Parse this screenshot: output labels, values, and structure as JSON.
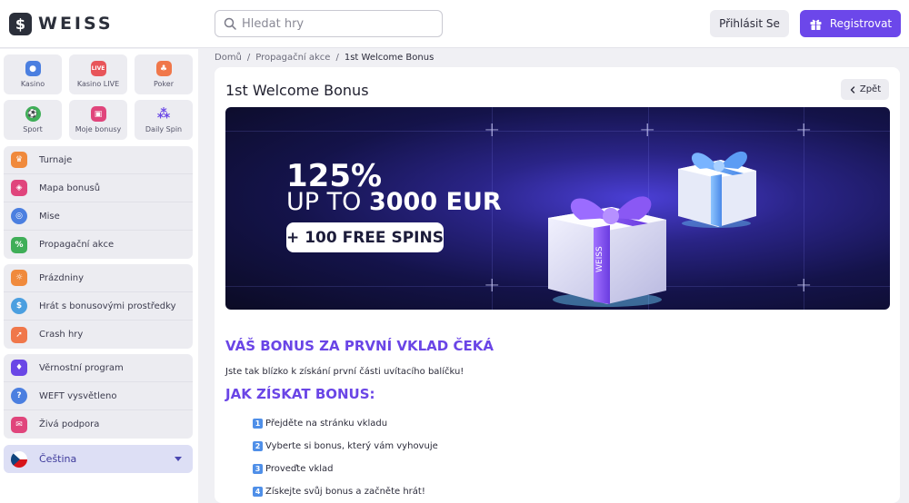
{
  "header": {
    "logo_text": "WEISS",
    "logo_mark": "$",
    "search_placeholder": "Hledat hry",
    "login_label": "Přihlásit Se",
    "register_label": "Registrovat"
  },
  "sidebar": {
    "tiles": [
      {
        "label": "Kasino",
        "icon": "casino-icon",
        "color": "#4b7fe0"
      },
      {
        "label": "Kasino LIVE",
        "icon": "live-casino-icon",
        "color": "#e8555a"
      },
      {
        "label": "Poker",
        "icon": "poker-icon",
        "color": "#f0774a"
      },
      {
        "label": "Sport",
        "icon": "sport-icon",
        "color": "#3fae58"
      },
      {
        "label": "Moje bonusy",
        "icon": "bonuses-icon",
        "color": "#e0457c"
      },
      {
        "label": "Daily Spin",
        "icon": "daily-spin-icon",
        "color": "#6a47e6"
      }
    ],
    "group1": [
      {
        "label": "Turnaje",
        "icon": "trophy-icon",
        "color": "#f08a3c"
      },
      {
        "label": "Mapa bonusů",
        "icon": "bonus-map-icon",
        "color": "#e0457c"
      },
      {
        "label": "Mise",
        "icon": "target-icon",
        "color": "#4b7fe0"
      },
      {
        "label": "Propagační akce",
        "icon": "promo-icon",
        "color": "#3fae58"
      }
    ],
    "group2": [
      {
        "label": "Prázdniny",
        "icon": "holiday-icon",
        "color": "#f08a3c"
      },
      {
        "label": "Hrát s bonusovými prostředky",
        "icon": "bonus-funds-icon",
        "color": "#4b9fe0"
      },
      {
        "label": "Crash hry",
        "icon": "rocket-icon",
        "color": "#f0774a"
      }
    ],
    "group3": [
      {
        "label": "Věrnostní program",
        "icon": "loyalty-icon",
        "color": "#6a47e6"
      },
      {
        "label": "WEFT vysvětleno",
        "icon": "help-icon",
        "color": "#4b7fe0"
      },
      {
        "label": "Živá podpora",
        "icon": "chat-icon",
        "color": "#e0457c"
      }
    ],
    "language": "Čeština"
  },
  "breadcrumb": {
    "home": "Domů",
    "section": "Propagační akce",
    "current": "1st Welcome Bonus",
    "separator": "/"
  },
  "page": {
    "title": "1st Welcome Bonus",
    "back_label": "Zpět"
  },
  "banner": {
    "percent": "125%",
    "up_to": "UP TO",
    "amount": "3000 EUR",
    "spins": "+ 100 FREE SPINS",
    "gift_brand": "WEISS"
  },
  "content": {
    "heading_bonus": "VÁŠ BONUS ZA PRVNÍ VKLAD ČEKÁ",
    "intro": "Jste tak blízko k získání první části uvítacího balíčku!",
    "heading_how": "JAK ZÍSKAT BONUS:",
    "steps": [
      {
        "num": "1",
        "text": "Přejděte na stránku vkladu"
      },
      {
        "num": "2",
        "text": "Vyberte si bonus, který vám vyhovuje"
      },
      {
        "num": "3",
        "text": "Proveďte vklad"
      },
      {
        "num": "4",
        "text": "Získejte svůj bonus a začněte hrát!"
      }
    ]
  },
  "colors": {
    "accent": "#6c47ea",
    "heading": "#6a45e6",
    "banner_dark": "#0b0b24"
  }
}
